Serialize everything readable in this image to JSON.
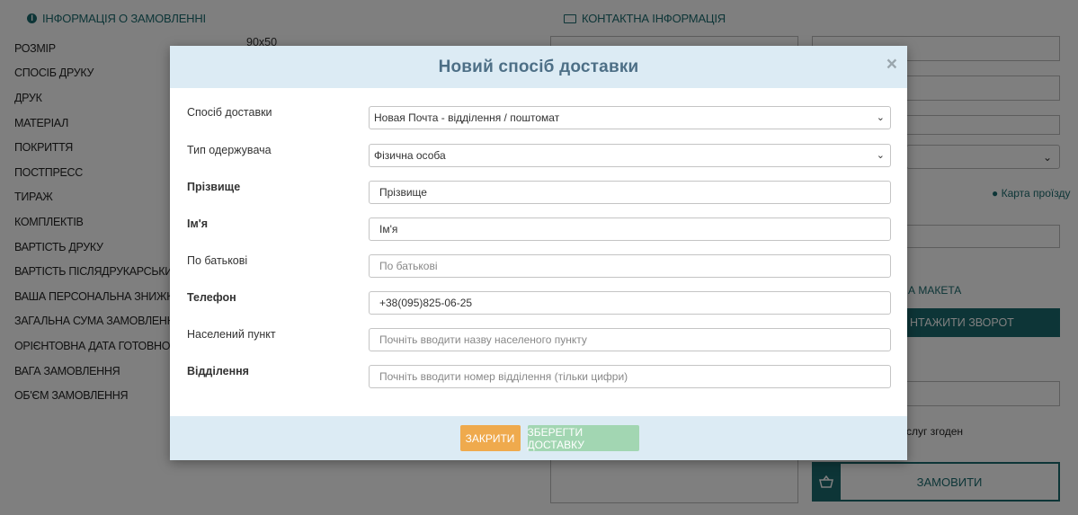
{
  "background": {
    "order_info": {
      "title": "ІНФОРМАЦІЯ О ЗАМОВЛЕННІ",
      "size_value": "90x50",
      "rows": [
        "РОЗМІР",
        "СПОСІБ ДРУКУ",
        "ДРУК",
        "МАТЕРІАЛ",
        "ПОКРИТТЯ",
        "ПОСТПРЕСС",
        "ТИРАЖ",
        "КОМПЛЕКТІВ",
        "ВАРТІСТЬ ДРУКУ",
        "ВАРТІСТЬ ПІСЛЯДРУКАРСЬКИХ РОБ",
        "ВАША ПЕРСОНАЛЬНА ЗНИЖКА",
        "ЗАГАЛЬНА СУМА ЗАМОВЛЕННЯ",
        "ОРІЄНТОВНА ДАТА ГОТОВНОСТІ ЗАМ",
        "ВАГА ЗАМОВЛЕННЯ",
        "ОБ'ЄМ ЗАМОВЛЕННЯ"
      ]
    },
    "contact": {
      "title": "КОНТАКТНА ІНФОРМАЦІЯ",
      "map_link": "Карта проїзду",
      "maket_label": "А МАКЕТА",
      "upload_button": "НТАЖИТИ ЗВОРОТ",
      "agree_text": "слуг згоден",
      "order_button": "ЗАМОВИТИ"
    }
  },
  "modal": {
    "title": "Новий спосіб доставки",
    "close_symbol": "×",
    "fields": {
      "delivery": {
        "label": "Спосіб доставки",
        "value": "Новая Почта - відділення / поштомат"
      },
      "recipient_type": {
        "label": "Тип одержувача",
        "value": "Фізична особа"
      },
      "surname": {
        "label": "Прізвище",
        "value": "Прізвище"
      },
      "name": {
        "label": "Ім'я",
        "value": "Ім'я"
      },
      "patronymic": {
        "label": "По батькові",
        "placeholder": "По батькові"
      },
      "phone": {
        "label": "Телефон",
        "value": "+38(095)825-06-25"
      },
      "city": {
        "label": "Населений пункт",
        "placeholder": "Почніть вводити назву населеного пункту"
      },
      "branch": {
        "label": "Відділення",
        "placeholder": "Почніть вводити номер відділення (тільки цифри)"
      }
    },
    "buttons": {
      "close": "ЗАКРИТИ",
      "save": "ЗБЕРЕГТИ ДОСТАВКУ"
    }
  },
  "colors": {
    "accent": "#1a6b6e",
    "modal_header": "#dcebf4",
    "title_text": "#4d6f86",
    "close_button": "#efaa4d",
    "save_button": "#a2d6b2"
  }
}
